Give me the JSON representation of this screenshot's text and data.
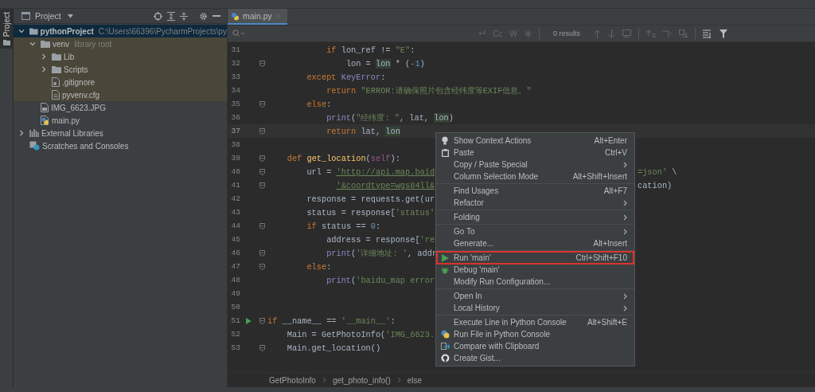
{
  "left_strip": {
    "label": "Project",
    "selected": true
  },
  "project_panel": {
    "title": "Project",
    "tree": [
      {
        "label": "pythonProject",
        "note": "C:\\Users\\66396\\PycharmProjects\\py",
        "kind": "project",
        "expanded": true,
        "selected": true,
        "highlighted": false,
        "children": [
          {
            "label": "venv",
            "note": "library root",
            "kind": "folder",
            "expanded": true,
            "selected": false,
            "highlighted": true,
            "children": [
              {
                "label": "Lib",
                "kind": "folder",
                "expanded": false,
                "selected": false,
                "highlighted": true
              },
              {
                "label": "Scripts",
                "kind": "folder",
                "expanded": false,
                "selected": false,
                "highlighted": true
              },
              {
                "label": ".gitignore",
                "kind": "git",
                "selected": false,
                "highlighted": true
              },
              {
                "label": "pyvenv.cfg",
                "kind": "config",
                "selected": false,
                "highlighted": true
              }
            ]
          },
          {
            "label": "IMG_6623.JPG",
            "kind": "image",
            "selected": false,
            "highlighted": false
          },
          {
            "label": "main.py",
            "kind": "python",
            "selected": false,
            "highlighted": false
          }
        ]
      },
      {
        "label": "External Libraries",
        "kind": "library",
        "expanded": false,
        "selected": false,
        "highlighted": false
      },
      {
        "label": "Scratches and Consoles",
        "kind": "scratch",
        "selected": false,
        "highlighted": false
      }
    ]
  },
  "editor": {
    "tabs": [
      {
        "label": "main.py",
        "selected": true
      }
    ],
    "search": {
      "options": [
        "Cc",
        "W"
      ],
      "results": "0 results"
    },
    "lines": [
      {
        "number": "31",
        "fold": false,
        "current": false,
        "run": false,
        "tokens": [
          {
            "kind": "kw",
            "text": "            if"
          },
          {
            "kind": "plain",
            "text": " lon_ref != "
          },
          {
            "kind": "str",
            "text": "\"E\""
          },
          {
            "kind": "plain",
            "text": ":"
          }
        ]
      },
      {
        "number": "32",
        "fold": true,
        "current": false,
        "run": false,
        "tokens": [
          {
            "kind": "plain",
            "text": "                lon = "
          },
          {
            "kind": "hl",
            "text": "lon"
          },
          {
            "kind": "plain",
            "text": " * ("
          },
          {
            "kind": "num",
            "text": "-1"
          },
          {
            "kind": "plain",
            "text": ")"
          }
        ]
      },
      {
        "number": "33",
        "fold": false,
        "current": false,
        "run": false,
        "tokens": [
          {
            "kind": "kw",
            "text": "        except"
          },
          {
            "kind": "builtin",
            "text": " KeyError"
          },
          {
            "kind": "plain",
            "text": ":"
          }
        ]
      },
      {
        "number": "34",
        "fold": false,
        "current": false,
        "run": false,
        "tokens": [
          {
            "kind": "kw",
            "text": "            return"
          },
          {
            "kind": "str",
            "text": " \"ERROR:请确保照片包含经纬度等EXIF信息。\""
          }
        ]
      },
      {
        "number": "35",
        "fold": true,
        "current": false,
        "run": false,
        "tokens": [
          {
            "kind": "kw",
            "text": "        else"
          },
          {
            "kind": "plain",
            "text": ":"
          }
        ]
      },
      {
        "number": "36",
        "fold": false,
        "current": false,
        "run": false,
        "tokens": [
          {
            "kind": "builtin",
            "text": "            print"
          },
          {
            "kind": "plain",
            "text": "("
          },
          {
            "kind": "str",
            "text": "\"经纬度: \""
          },
          {
            "kind": "plain",
            "text": ", lat, "
          },
          {
            "kind": "hl",
            "text": "lon"
          },
          {
            "kind": "plain",
            "text": ")"
          }
        ]
      },
      {
        "number": "37",
        "fold": true,
        "current": true,
        "run": false,
        "tokens": [
          {
            "kind": "kw",
            "text": "            return"
          },
          {
            "kind": "plain",
            "text": " lat, "
          },
          {
            "kind": "hl",
            "text": "lon"
          }
        ]
      },
      {
        "number": "38",
        "fold": false,
        "current": false,
        "run": false
      },
      {
        "number": "39",
        "fold": true,
        "current": false,
        "run": false,
        "tokens": [
          {
            "kind": "kw",
            "text": "    def"
          },
          {
            "kind": "fn",
            "text": " get_location"
          },
          {
            "kind": "plain",
            "text": "("
          },
          {
            "kind": "self",
            "text": "self"
          },
          {
            "kind": "plain",
            "text": "):"
          }
        ]
      },
      {
        "number": "40",
        "fold": true,
        "current": false,
        "run": false,
        "tokens": [
          {
            "kind": "plain",
            "text": "        url = "
          },
          {
            "kind": "link",
            "text": "'http://api.map.baid"
          }
        ],
        "text_after_menu": [
          {
            "kind": "str",
            "text": "=json'"
          },
          {
            "kind": "plain",
            "text": " \\"
          }
        ]
      },
      {
        "number": "41",
        "fold": true,
        "current": false,
        "run": false,
        "tokens": [
          {
            "kind": "link",
            "text": "              '&coordtype=wgs84ll&"
          }
        ],
        "text_after_menu": [
          {
            "kind": "plain",
            "text": "cation)"
          }
        ]
      },
      {
        "number": "42",
        "fold": false,
        "current": false,
        "run": false,
        "tokens": [
          {
            "kind": "plain",
            "text": "        response = requests.get(ur"
          }
        ]
      },
      {
        "number": "43",
        "fold": false,
        "current": false,
        "run": false,
        "tokens": [
          {
            "kind": "plain",
            "text": "        status = response["
          },
          {
            "kind": "str",
            "text": "'status'"
          }
        ]
      },
      {
        "number": "44",
        "fold": true,
        "current": false,
        "run": false,
        "tokens": [
          {
            "kind": "kw",
            "text": "        if"
          },
          {
            "kind": "plain",
            "text": " status == "
          },
          {
            "kind": "num",
            "text": "0"
          },
          {
            "kind": "plain",
            "text": ":"
          }
        ]
      },
      {
        "number": "45",
        "fold": false,
        "current": false,
        "run": false,
        "tokens": [
          {
            "kind": "plain",
            "text": "            address = response["
          },
          {
            "kind": "str",
            "text": "'re"
          }
        ]
      },
      {
        "number": "46",
        "fold": true,
        "current": false,
        "run": false,
        "tokens": [
          {
            "kind": "builtin",
            "text": "            print"
          },
          {
            "kind": "plain",
            "text": "("
          },
          {
            "kind": "str",
            "text": "'详细地址: '"
          },
          {
            "kind": "plain",
            "text": ", addr"
          }
        ]
      },
      {
        "number": "47",
        "fold": true,
        "current": false,
        "run": false,
        "tokens": [
          {
            "kind": "kw",
            "text": "        else"
          },
          {
            "kind": "plain",
            "text": ":"
          }
        ]
      },
      {
        "number": "48",
        "fold": false,
        "current": false,
        "run": false,
        "tokens": [
          {
            "kind": "builtin",
            "text": "            print"
          },
          {
            "kind": "plain",
            "text": "("
          },
          {
            "kind": "str",
            "text": "'baidu_map error"
          }
        ]
      },
      {
        "number": "49",
        "fold": false,
        "current": false,
        "run": false
      },
      {
        "number": "50",
        "fold": false,
        "current": false,
        "run": false
      },
      {
        "number": "51",
        "fold": true,
        "current": false,
        "run": true,
        "tokens": [
          {
            "kind": "kw",
            "text": "if"
          },
          {
            "kind": "plain",
            "text": " __name__ == "
          },
          {
            "kind": "str",
            "text": "'__main__'"
          },
          {
            "kind": "plain",
            "text": ":"
          }
        ]
      },
      {
        "number": "52",
        "fold": false,
        "current": false,
        "run": false,
        "tokens": [
          {
            "kind": "plain",
            "text": "    Main = GetPhotoInfo("
          },
          {
            "kind": "str",
            "text": "'IMG_6623."
          }
        ]
      },
      {
        "number": "53",
        "fold": true,
        "current": false,
        "run": false,
        "tokens": [
          {
            "kind": "plain",
            "text": "    Main.get_location()"
          }
        ]
      }
    ],
    "breadcrumbs": [
      "GetPhotoInfo",
      "get_photo_info()",
      "else"
    ]
  },
  "context_menu": {
    "groups": [
      {
        "items": [
          {
            "label": "Show Context Actions",
            "shortcut": "Alt+Enter",
            "kind": "bulb",
            "submenu": false,
            "highlighted": false
          },
          {
            "label": "Paste",
            "shortcut": "Ctrl+V",
            "kind": "clipboard",
            "submenu": false,
            "highlighted": false
          },
          {
            "label": "Copy / Paste Special",
            "kind": "plain",
            "submenu": true,
            "highlighted": false
          },
          {
            "label": "Column Selection Mode",
            "shortcut": "Alt+Shift+Insert",
            "kind": "plain",
            "submenu": false,
            "highlighted": false
          }
        ]
      },
      {
        "items": [
          {
            "label": "Find Usages",
            "shortcut": "Alt+F7",
            "kind": "plain",
            "submenu": false,
            "highlighted": false
          },
          {
            "label": "Refactor",
            "kind": "plain",
            "submenu": true,
            "highlighted": false
          }
        ]
      },
      {
        "items": [
          {
            "label": "Folding",
            "kind": "plain",
            "submenu": true,
            "highlighted": false
          }
        ]
      },
      {
        "items": [
          {
            "label": "Go To",
            "kind": "plain",
            "submenu": true,
            "highlighted": false
          },
          {
            "label": "Generate...",
            "shortcut": "Alt+Insert",
            "kind": "plain",
            "submenu": false,
            "highlighted": false
          }
        ]
      },
      {
        "items": [
          {
            "label": "Run 'main'",
            "shortcut": "Ctrl+Shift+F10",
            "kind": "play",
            "submenu": false,
            "highlighted": true
          },
          {
            "label": "Debug 'main'",
            "kind": "bug",
            "submenu": false,
            "highlighted": false
          },
          {
            "label": "Modify Run Configuration...",
            "kind": "plain",
            "submenu": false,
            "highlighted": false
          }
        ]
      },
      {
        "items": [
          {
            "label": "Open In",
            "kind": "plain",
            "submenu": true,
            "highlighted": false
          },
          {
            "label": "Local History",
            "kind": "plain",
            "submenu": true,
            "highlighted": false
          }
        ]
      },
      {
        "items": [
          {
            "label": "Execute Line in Python Console",
            "shortcut": "Alt+Shift+E",
            "kind": "plain",
            "submenu": false,
            "highlighted": false
          },
          {
            "label": "Run File in Python Console",
            "kind": "python",
            "submenu": false,
            "highlighted": false
          },
          {
            "label": "Compare with Clipboard",
            "kind": "compare",
            "submenu": false,
            "highlighted": false
          },
          {
            "label": "Create Gist...",
            "kind": "gist",
            "submenu": false,
            "highlighted": false
          }
        ]
      }
    ]
  }
}
